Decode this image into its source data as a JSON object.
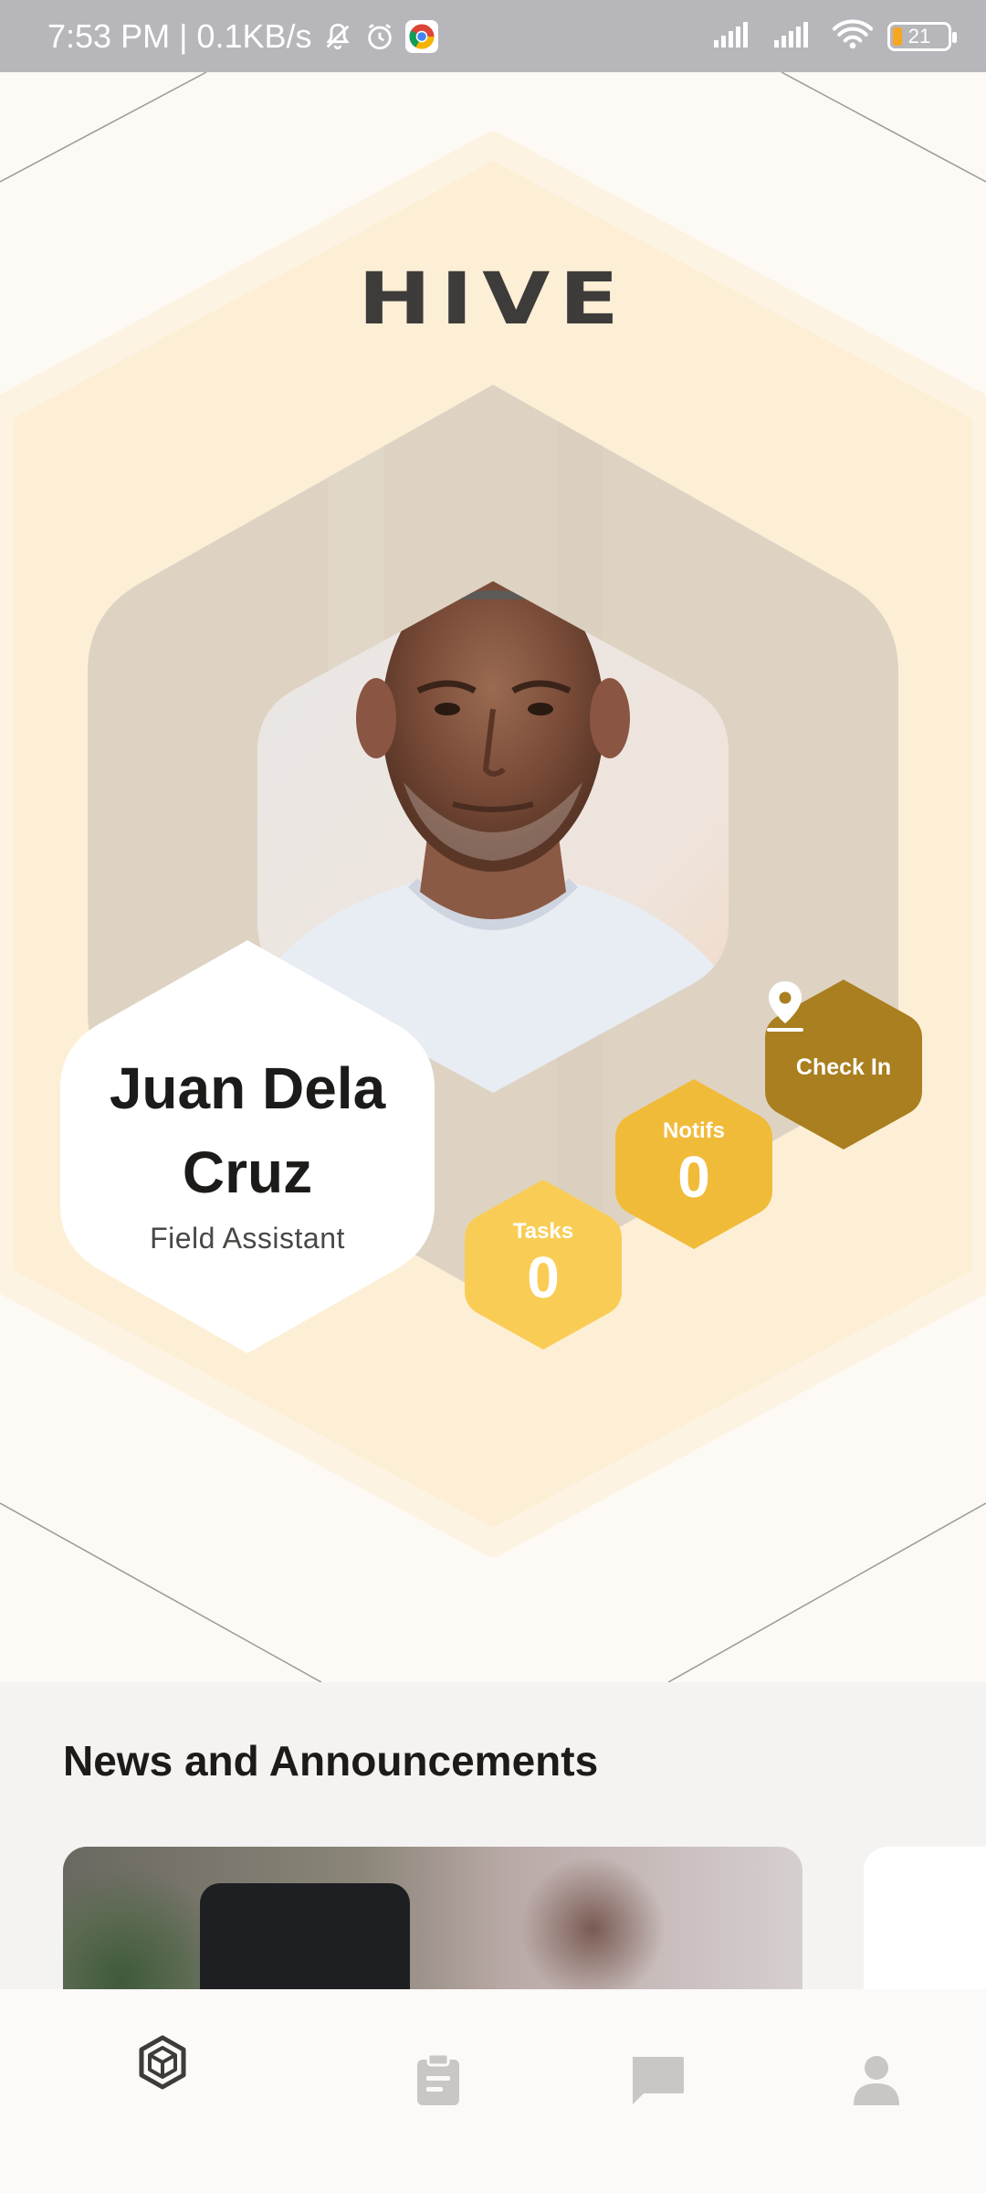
{
  "status_bar": {
    "time_speed": "7:53 PM | 0.1KB/s",
    "battery": "21",
    "icons": [
      "mute-bell-icon",
      "alarm-icon",
      "chrome-icon",
      "signal-icon",
      "signal-icon",
      "wifi-icon",
      "battery-icon"
    ]
  },
  "app": {
    "logo": "HIVE"
  },
  "profile": {
    "name": "Juan Dela Cruz",
    "role": "Field Assistant"
  },
  "stats": {
    "check_in_label": "Check In",
    "notifs_label": "Notifs",
    "notifs_value": "0",
    "tasks_label": "Tasks",
    "tasks_value": "0"
  },
  "news": {
    "title": "News and Announcements"
  },
  "bottom_nav": {
    "items": [
      {
        "icon": "hive-home-icon",
        "active": true
      },
      {
        "icon": "clipboard-icon",
        "active": false
      },
      {
        "icon": "chat-icon",
        "active": false
      },
      {
        "icon": "person-icon",
        "active": false
      }
    ]
  },
  "colors": {
    "check_in": "#a97f1f",
    "notifs": "#f1bb3a",
    "tasks": "#f9cd55",
    "hex_outer": "#fdefd6",
    "hex_inner": "#dfd3c2"
  }
}
